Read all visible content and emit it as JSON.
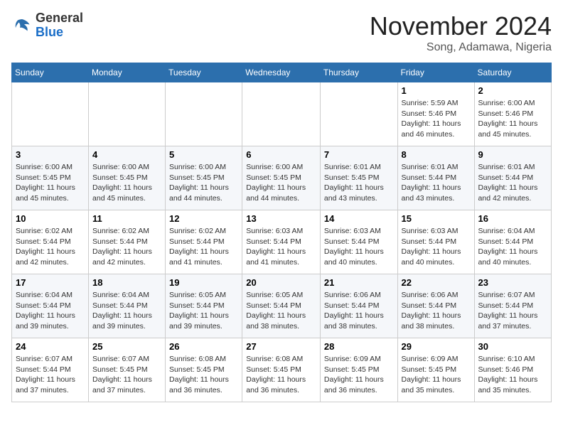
{
  "logo": {
    "general": "General",
    "blue": "Blue"
  },
  "title": "November 2024",
  "location": "Song, Adamawa, Nigeria",
  "days_header": [
    "Sunday",
    "Monday",
    "Tuesday",
    "Wednesday",
    "Thursday",
    "Friday",
    "Saturday"
  ],
  "weeks": [
    [
      {
        "day": "",
        "info": ""
      },
      {
        "day": "",
        "info": ""
      },
      {
        "day": "",
        "info": ""
      },
      {
        "day": "",
        "info": ""
      },
      {
        "day": "",
        "info": ""
      },
      {
        "day": "1",
        "info": "Sunrise: 5:59 AM\nSunset: 5:46 PM\nDaylight: 11 hours and 46 minutes."
      },
      {
        "day": "2",
        "info": "Sunrise: 6:00 AM\nSunset: 5:46 PM\nDaylight: 11 hours and 45 minutes."
      }
    ],
    [
      {
        "day": "3",
        "info": "Sunrise: 6:00 AM\nSunset: 5:45 PM\nDaylight: 11 hours and 45 minutes."
      },
      {
        "day": "4",
        "info": "Sunrise: 6:00 AM\nSunset: 5:45 PM\nDaylight: 11 hours and 45 minutes."
      },
      {
        "day": "5",
        "info": "Sunrise: 6:00 AM\nSunset: 5:45 PM\nDaylight: 11 hours and 44 minutes."
      },
      {
        "day": "6",
        "info": "Sunrise: 6:00 AM\nSunset: 5:45 PM\nDaylight: 11 hours and 44 minutes."
      },
      {
        "day": "7",
        "info": "Sunrise: 6:01 AM\nSunset: 5:45 PM\nDaylight: 11 hours and 43 minutes."
      },
      {
        "day": "8",
        "info": "Sunrise: 6:01 AM\nSunset: 5:44 PM\nDaylight: 11 hours and 43 minutes."
      },
      {
        "day": "9",
        "info": "Sunrise: 6:01 AM\nSunset: 5:44 PM\nDaylight: 11 hours and 42 minutes."
      }
    ],
    [
      {
        "day": "10",
        "info": "Sunrise: 6:02 AM\nSunset: 5:44 PM\nDaylight: 11 hours and 42 minutes."
      },
      {
        "day": "11",
        "info": "Sunrise: 6:02 AM\nSunset: 5:44 PM\nDaylight: 11 hours and 42 minutes."
      },
      {
        "day": "12",
        "info": "Sunrise: 6:02 AM\nSunset: 5:44 PM\nDaylight: 11 hours and 41 minutes."
      },
      {
        "day": "13",
        "info": "Sunrise: 6:03 AM\nSunset: 5:44 PM\nDaylight: 11 hours and 41 minutes."
      },
      {
        "day": "14",
        "info": "Sunrise: 6:03 AM\nSunset: 5:44 PM\nDaylight: 11 hours and 40 minutes."
      },
      {
        "day": "15",
        "info": "Sunrise: 6:03 AM\nSunset: 5:44 PM\nDaylight: 11 hours and 40 minutes."
      },
      {
        "day": "16",
        "info": "Sunrise: 6:04 AM\nSunset: 5:44 PM\nDaylight: 11 hours and 40 minutes."
      }
    ],
    [
      {
        "day": "17",
        "info": "Sunrise: 6:04 AM\nSunset: 5:44 PM\nDaylight: 11 hours and 39 minutes."
      },
      {
        "day": "18",
        "info": "Sunrise: 6:04 AM\nSunset: 5:44 PM\nDaylight: 11 hours and 39 minutes."
      },
      {
        "day": "19",
        "info": "Sunrise: 6:05 AM\nSunset: 5:44 PM\nDaylight: 11 hours and 39 minutes."
      },
      {
        "day": "20",
        "info": "Sunrise: 6:05 AM\nSunset: 5:44 PM\nDaylight: 11 hours and 38 minutes."
      },
      {
        "day": "21",
        "info": "Sunrise: 6:06 AM\nSunset: 5:44 PM\nDaylight: 11 hours and 38 minutes."
      },
      {
        "day": "22",
        "info": "Sunrise: 6:06 AM\nSunset: 5:44 PM\nDaylight: 11 hours and 38 minutes."
      },
      {
        "day": "23",
        "info": "Sunrise: 6:07 AM\nSunset: 5:44 PM\nDaylight: 11 hours and 37 minutes."
      }
    ],
    [
      {
        "day": "24",
        "info": "Sunrise: 6:07 AM\nSunset: 5:44 PM\nDaylight: 11 hours and 37 minutes."
      },
      {
        "day": "25",
        "info": "Sunrise: 6:07 AM\nSunset: 5:45 PM\nDaylight: 11 hours and 37 minutes."
      },
      {
        "day": "26",
        "info": "Sunrise: 6:08 AM\nSunset: 5:45 PM\nDaylight: 11 hours and 36 minutes."
      },
      {
        "day": "27",
        "info": "Sunrise: 6:08 AM\nSunset: 5:45 PM\nDaylight: 11 hours and 36 minutes."
      },
      {
        "day": "28",
        "info": "Sunrise: 6:09 AM\nSunset: 5:45 PM\nDaylight: 11 hours and 36 minutes."
      },
      {
        "day": "29",
        "info": "Sunrise: 6:09 AM\nSunset: 5:45 PM\nDaylight: 11 hours and 35 minutes."
      },
      {
        "day": "30",
        "info": "Sunrise: 6:10 AM\nSunset: 5:46 PM\nDaylight: 11 hours and 35 minutes."
      }
    ]
  ]
}
